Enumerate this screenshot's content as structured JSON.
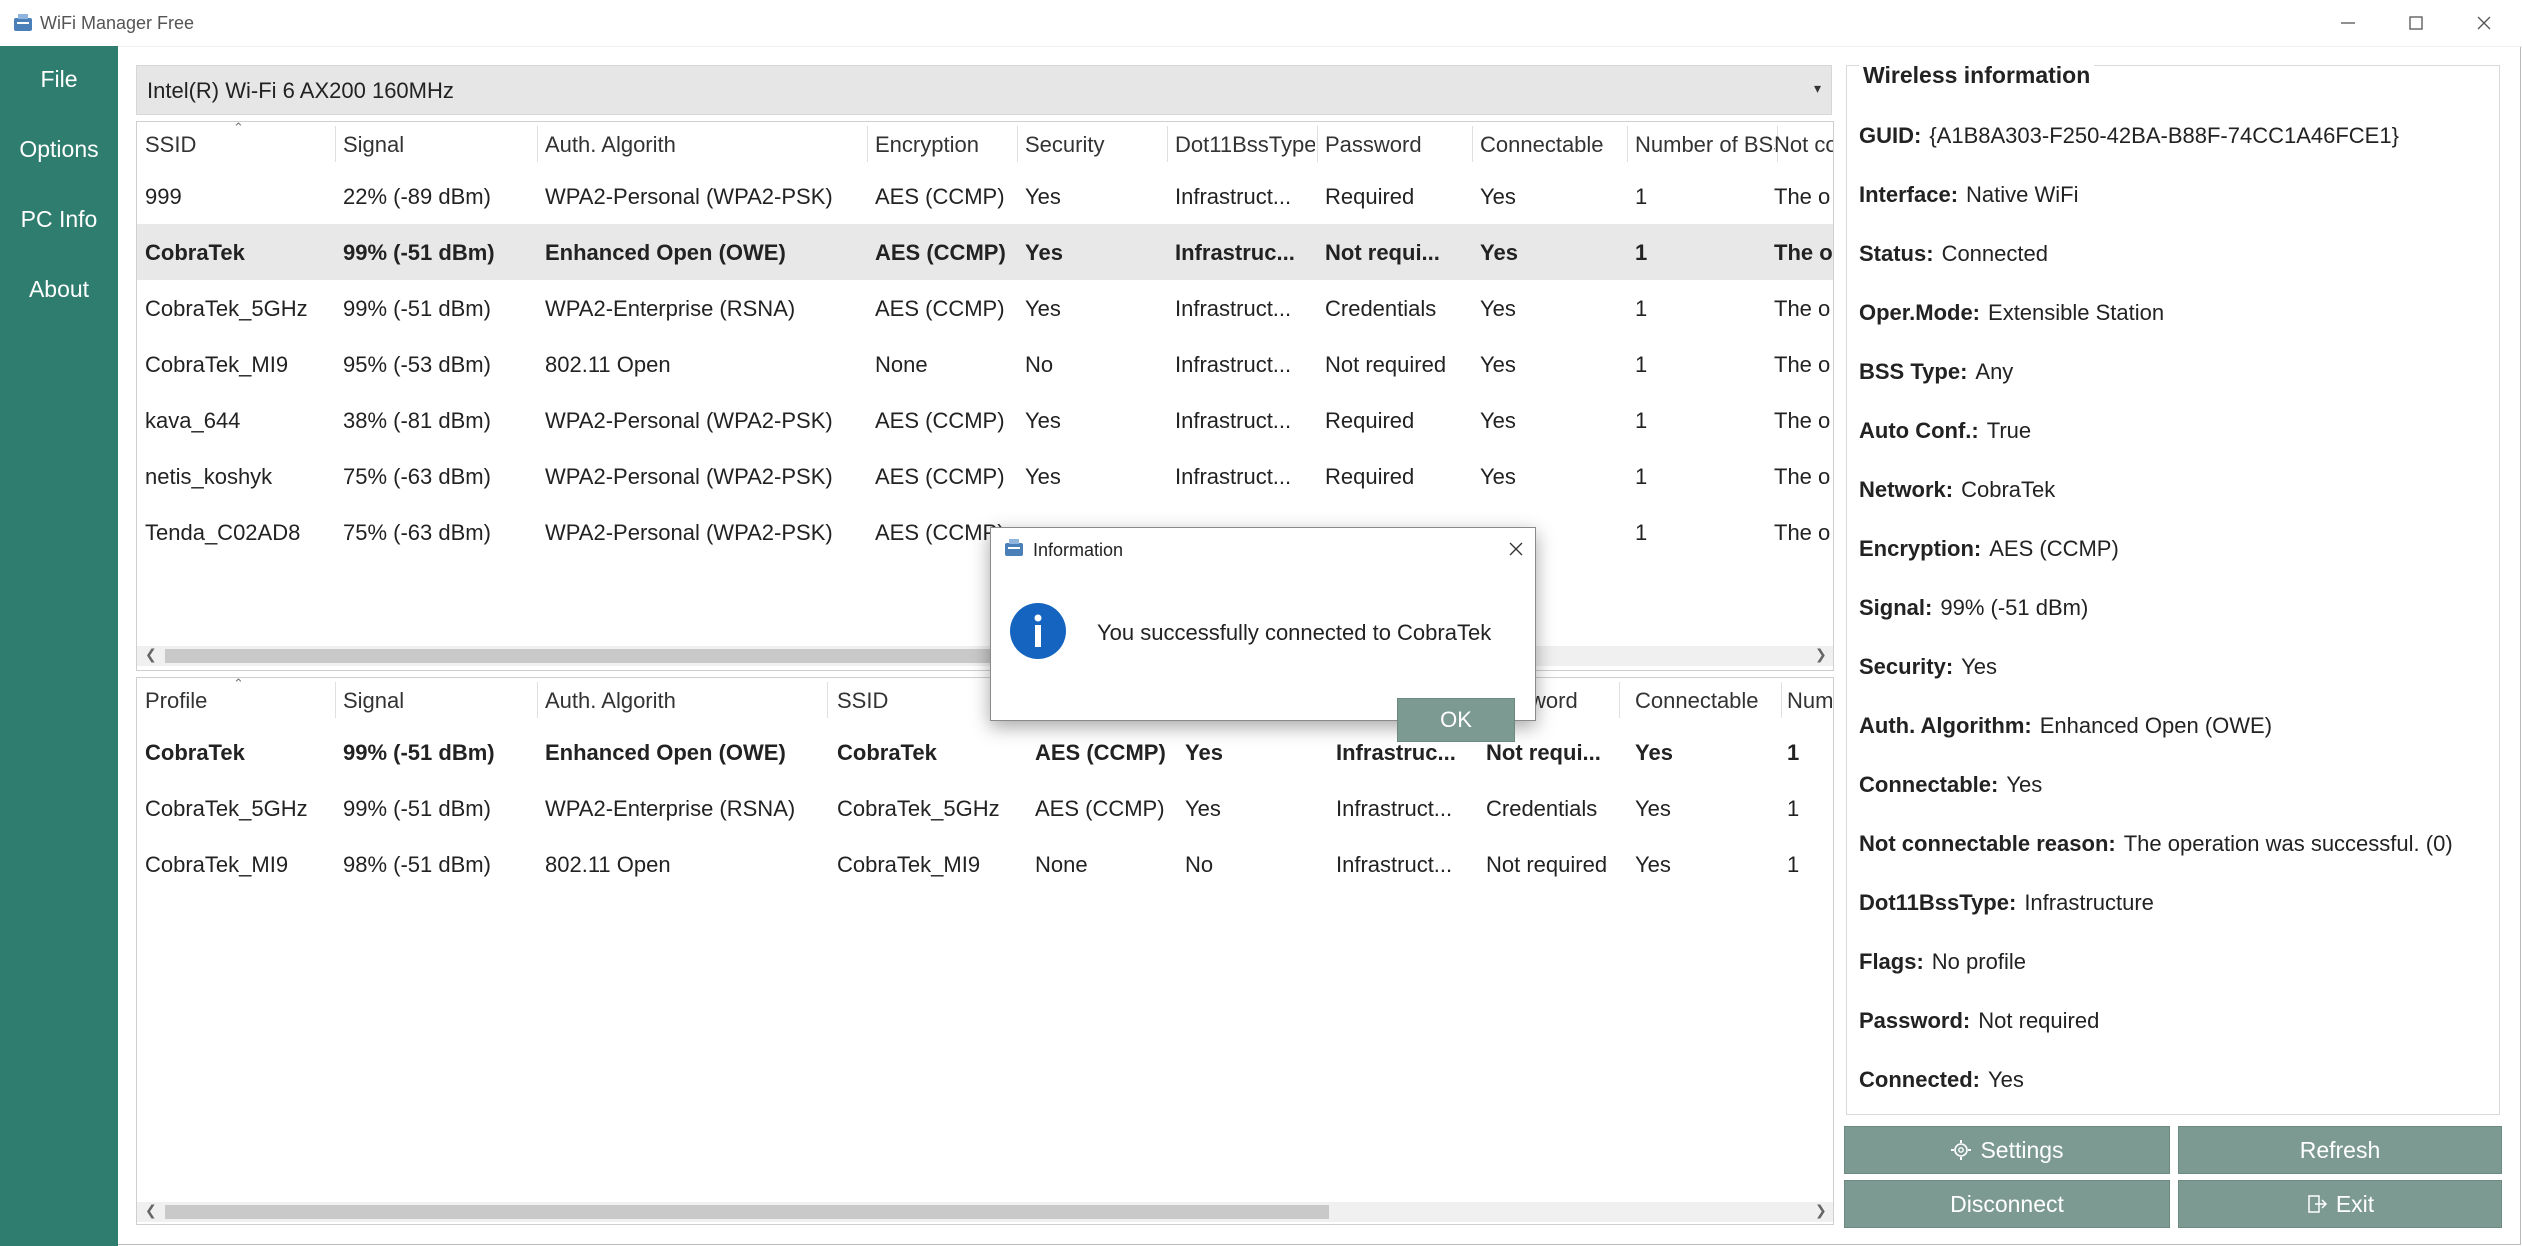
{
  "window": {
    "title": "WiFi Manager Free",
    "minimize_icon": "minimize-icon",
    "maximize_icon": "maximize-icon",
    "close_icon": "close-icon"
  },
  "sidebar": {
    "items": [
      {
        "label": "File"
      },
      {
        "label": "Options"
      },
      {
        "label": "PC Info"
      },
      {
        "label": "About"
      }
    ],
    "color": "#2e7d6e"
  },
  "adapter": {
    "selected": "Intel(R) Wi-Fi 6 AX200 160MHz"
  },
  "networks": {
    "columns": [
      "SSID",
      "Signal",
      "Auth. Algorith",
      "Encryption",
      "Security",
      "Dot11BssType",
      "Password",
      "Connectable",
      "Number of BSSIDs",
      "Not co"
    ],
    "rows": [
      [
        "999",
        "22% (-89 dBm)",
        "WPA2-Personal (WPA2-PSK)",
        "AES (CCMP)",
        "Yes",
        "Infrastruct...",
        "Required",
        "Yes",
        "1",
        "The o"
      ],
      [
        "CobraTek",
        "99% (-51 dBm)",
        "Enhanced Open (OWE)",
        "AES (CCMP)",
        "Yes",
        "Infrastruc...",
        "Not requi...",
        "Yes",
        "1",
        "The o"
      ],
      [
        "CobraTek_5GHz",
        "99% (-51 dBm)",
        "WPA2-Enterprise (RSNA)",
        "AES (CCMP)",
        "Yes",
        "Infrastruct...",
        "Credentials",
        "Yes",
        "1",
        "The o"
      ],
      [
        "CobraTek_MI9",
        "95% (-53 dBm)",
        "802.11 Open",
        "None",
        "No",
        "Infrastruct...",
        "Not required",
        "Yes",
        "1",
        "The o"
      ],
      [
        "kava_644",
        "38% (-81 dBm)",
        "WPA2-Personal (WPA2-PSK)",
        "AES (CCMP)",
        "Yes",
        "Infrastruct...",
        "Required",
        "Yes",
        "1",
        "The o"
      ],
      [
        "netis_koshyk",
        "75% (-63 dBm)",
        "WPA2-Personal (WPA2-PSK)",
        "AES (CCMP)",
        "Yes",
        "Infrastruct...",
        "Required",
        "Yes",
        "1",
        "The o"
      ],
      [
        "Tenda_C02AD8",
        "75% (-63 dBm)",
        "WPA2-Personal (WPA2-PSK)",
        "AES (CCMP)",
        "",
        "",
        "",
        "",
        "1",
        "The o"
      ]
    ]
  },
  "profiles": {
    "columns": [
      "Profile",
      "Signal",
      "Auth. Algorith",
      "SSID",
      "",
      "",
      "",
      "word",
      "Connectable",
      "Num"
    ],
    "rows": [
      [
        "CobraTek",
        "99% (-51 dBm)",
        "Enhanced Open (OWE)",
        "CobraTek",
        "AES (CCMP)",
        "Yes",
        "Infrastruc...",
        "Not requi...",
        "Yes",
        "1"
      ],
      [
        "CobraTek_5GHz",
        "99% (-51 dBm)",
        "WPA2-Enterprise (RSNA)",
        "CobraTek_5GHz",
        "AES (CCMP)",
        "Yes",
        "Infrastruct...",
        "Credentials",
        "Yes",
        "1"
      ],
      [
        "CobraTek_MI9",
        "98% (-51 dBm)",
        "802.11 Open",
        "CobraTek_MI9",
        "None",
        "No",
        "Infrastruct...",
        "Not required",
        "Yes",
        "1"
      ]
    ]
  },
  "info": {
    "title": "Wireless information",
    "fields": [
      {
        "label": "GUID:",
        "value": "{A1B8A303-F250-42BA-B88F-74CC1A46FCE1}"
      },
      {
        "label": "Interface:",
        "value": "Native WiFi"
      },
      {
        "label": "Status:",
        "value": "Connected"
      },
      {
        "label": "Oper.Mode:",
        "value": "Extensible Station"
      },
      {
        "label": "BSS Type:",
        "value": "Any"
      },
      {
        "label": "Auto Conf.:",
        "value": "True"
      },
      {
        "label": "Network:",
        "value": "CobraTek"
      },
      {
        "label": "Encryption:",
        "value": "AES (CCMP)"
      },
      {
        "label": "Signal:",
        "value": "99% (-51 dBm)"
      },
      {
        "label": "Security:",
        "value": "Yes"
      },
      {
        "label": "Auth. Algorithm:",
        "value": "Enhanced Open (OWE)"
      },
      {
        "label": "Connectable:",
        "value": "Yes"
      },
      {
        "label": "Not connectable reason:",
        "value": "The operation was successful. (0)"
      },
      {
        "label": "Dot11BssType:",
        "value": "Infrastructure"
      },
      {
        "label": "Flags:",
        "value": "No profile"
      },
      {
        "label": "Password:",
        "value": "Not required"
      },
      {
        "label": "Connected:",
        "value": "Yes"
      }
    ]
  },
  "buttons": {
    "settings": "Settings",
    "refresh": "Refresh",
    "disconnect": "Disconnect",
    "exit": "Exit",
    "settings_icon": "gear-icon",
    "exit_icon": "exit-icon"
  },
  "dialog": {
    "title": "Information",
    "message": "You successfully connected to CobraTek",
    "ok": "OK",
    "icon": "info-icon"
  }
}
